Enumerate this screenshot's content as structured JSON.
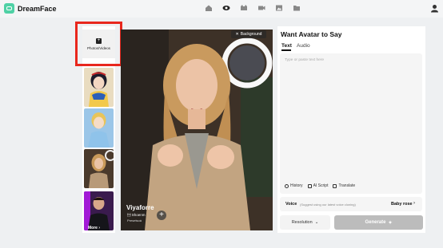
{
  "app": {
    "name": "DreamFace"
  },
  "nav": {
    "icons": [
      "home-icon",
      "avatar-icon",
      "cat-icon",
      "video-icon",
      "image-icon",
      "folder-icon"
    ]
  },
  "sidebar": {
    "upload_label": "Photos/Videos",
    "thumbnails": [
      "snow-white-thumb",
      "cinderella-thumb",
      "woman-thumb",
      "man-thumb"
    ],
    "more_label": "More"
  },
  "video": {
    "background_label": "Background",
    "name": "Viyaforre",
    "meta1": "\u0001 Shoenm",
    "meta2": "Presetsoá"
  },
  "panel": {
    "title": "Want Avatar to Say",
    "tabs": {
      "text": "Text",
      "audio": "Audio"
    },
    "placeholder": "Type or paste text here",
    "tools": {
      "history": "History",
      "ai_script": "AI Script",
      "translate": "Translate"
    },
    "voice": {
      "label": "Voice",
      "hint": "(Suggest using our latest voice cloning)",
      "value": "Baby rose"
    },
    "resolution_label": "Resolution",
    "generate_label": "Generate"
  },
  "colors": {
    "accent": "#4fd1a5",
    "highlight": "#e8271d",
    "generate_bg": "#bcbcbc"
  }
}
